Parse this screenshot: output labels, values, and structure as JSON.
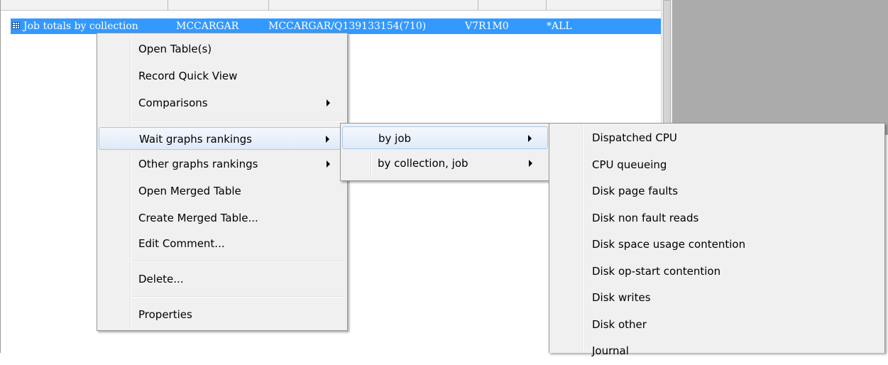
{
  "list": {
    "row": {
      "name": "Job totals by collection",
      "user": "MCCARGAR",
      "job": "MCCARGAR/Q139133154(710)",
      "release": "V7R1M0",
      "scope": "*ALL"
    }
  },
  "context_menu": {
    "items": [
      {
        "label": "Open Table(s)"
      },
      {
        "label": "Record Quick View"
      },
      {
        "label": "Comparisons"
      },
      {
        "label": "Wait graphs rankings"
      },
      {
        "label": "Other graphs rankings"
      },
      {
        "label": "Open Merged Table"
      },
      {
        "label": "Create Merged Table..."
      },
      {
        "label": "Edit Comment..."
      },
      {
        "label": "Delete..."
      },
      {
        "label": "Properties"
      }
    ]
  },
  "submenu_rankings": {
    "items": [
      {
        "label": "by job"
      },
      {
        "label": "by collection, job"
      }
    ]
  },
  "submenu_by_job": {
    "items": [
      {
        "label": "Dispatched CPU"
      },
      {
        "label": "CPU queueing"
      },
      {
        "label": "Disk page faults"
      },
      {
        "label": "Disk non fault reads"
      },
      {
        "label": "Disk space usage contention"
      },
      {
        "label": "Disk op-start contention"
      },
      {
        "label": "Disk writes"
      },
      {
        "label": "Disk other"
      },
      {
        "label": "Journal"
      }
    ]
  },
  "colors": {
    "selection": "#3399ff",
    "menu_background": "#f0f0f0",
    "highlight_border": "#a8c8ec",
    "gray_region": "#ababab"
  }
}
